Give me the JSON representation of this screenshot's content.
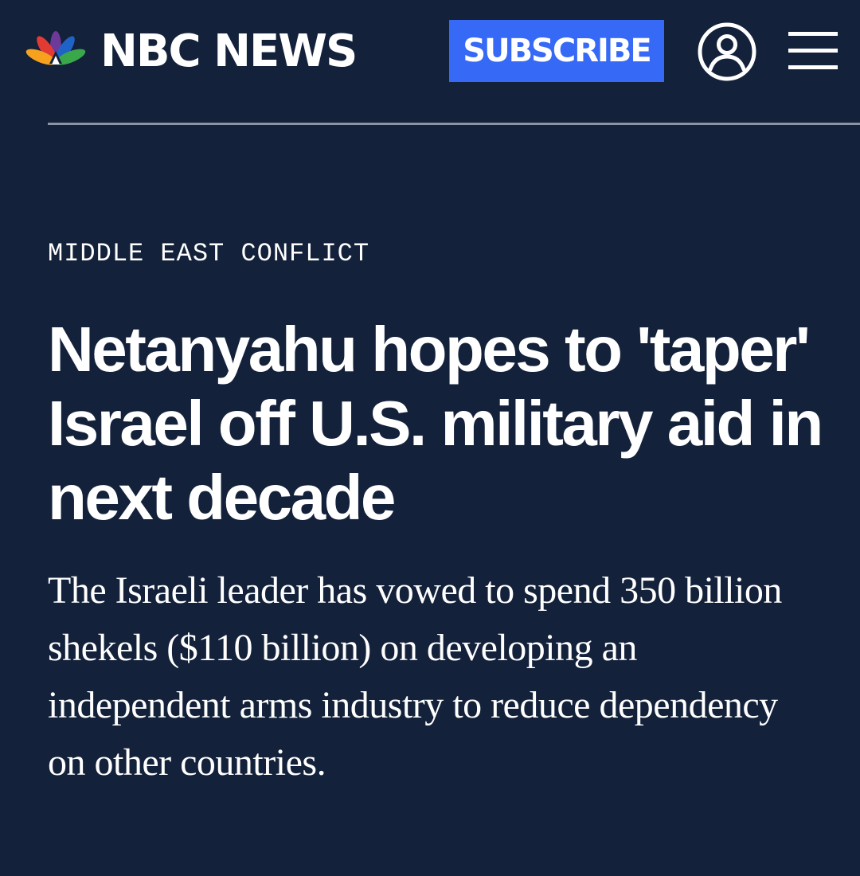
{
  "header": {
    "logo_text": "NBC NEWS",
    "subscribe_label": "SUBSCRIBE",
    "account_icon": "user-circle-icon",
    "menu_icon": "hamburger-menu-icon"
  },
  "article": {
    "category": "MIDDLE EAST CONFLICT",
    "headline": "Netanyahu hopes to 'taper' Israel off U.S. military aid in next decade",
    "dek": "The Israeli leader has vowed to spend 350 billion shekels ($110 billion) on developing an independent arms industry to reduce dependency on other countries."
  },
  "colors": {
    "background": "#13213a",
    "subscribe_button": "#3569f6",
    "divider": "#8b94a3",
    "text": "#ffffff"
  }
}
